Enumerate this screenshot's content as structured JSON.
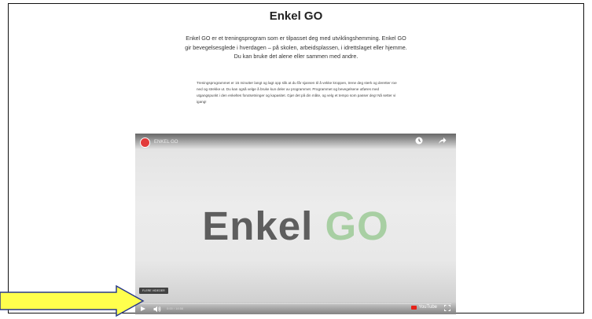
{
  "page": {
    "title": "Enkel GO",
    "intro": "Enkel GO er et treningsprogram som er tilpasset deg med utviklingshemming. Enkel GO gir bevegelsesglede i hverdagen – på skolen, arbeidsplassen, i idrettslaget eller hjemme. Du kan bruke det alene eller sammen med andre.",
    "body": "Treningsprogrammet er 15 minutter langt og lagt opp slik at du får sjansen til å vekke kroppen, trene deg sterk og deretter roe ned og strekke ut. Du kan også velge å bruke kun deler av programmet. Programmet og bevegelsene utføres med utgangspunkt i den enkeltes forutsetninger og kapasitet. Gjør det på din måte, og velg et tempo som passer deg! Nå setter vi igang!"
  },
  "video": {
    "channel_title": "ENKEL GO",
    "big_title_word1": "Enkel",
    "big_title_word2": "GO",
    "more_videos_label": "FLERE VIDEOER",
    "time": "0:00 / 14:56",
    "youtube_label": "YouTube"
  },
  "colors": {
    "go_green": "#a8cfa3",
    "enkel_gray": "#5e5e5e",
    "arrow_fill": "#ffff4d",
    "arrow_stroke": "#2a3a8a"
  }
}
